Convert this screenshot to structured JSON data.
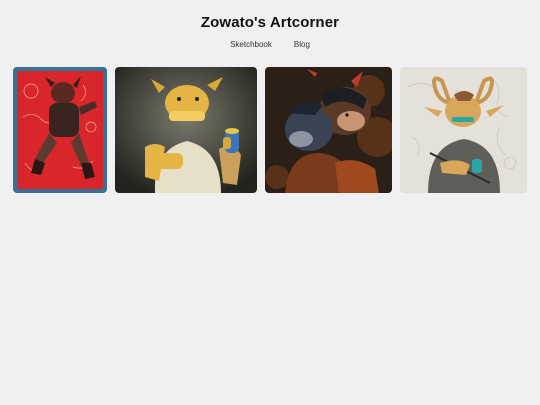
{
  "site": {
    "title": "Zowato's Artcorner"
  },
  "nav": {
    "items": [
      {
        "label": "Sketchbook"
      },
      {
        "label": "Blog"
      }
    ]
  },
  "gallery": {
    "items": [
      {
        "subject": "red-poster-character",
        "frame_color": "#3b6f93",
        "bg_color": "#d8262a"
      },
      {
        "subject": "horned-character-with-drink",
        "bg_color": "#3d3d36"
      },
      {
        "subject": "two-characters-autumn",
        "bg_color": "#2a2018"
      },
      {
        "subject": "horned-character-sketch",
        "bg_color": "#e4e0da"
      }
    ]
  }
}
